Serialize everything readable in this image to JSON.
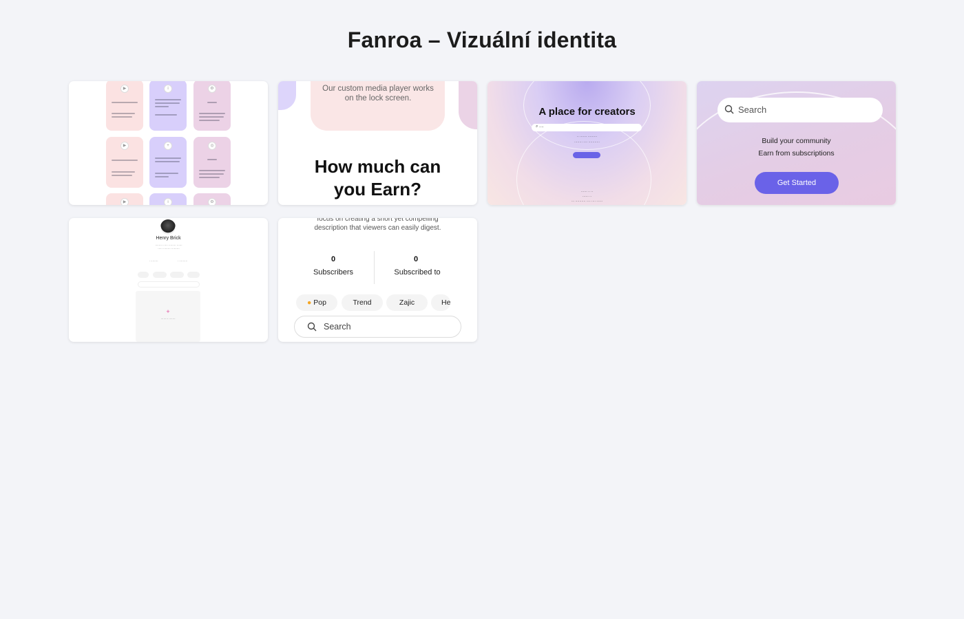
{
  "page": {
    "title": "Fanroa – Vizuální identita"
  },
  "cards": {
    "card2": {
      "text": "Our custom media player works on the lock screen.",
      "heading": "How much can you Earn?"
    },
    "card3": {
      "heading": "A place for creators"
    },
    "card4": {
      "search_placeholder": "Search",
      "line1": "Build your community",
      "line2": "Earn from subscriptions",
      "button": "Get Started"
    },
    "card5": {
      "name": "Henry Brick"
    },
    "card6": {
      "description": "focus on creating a short yet compelling description that viewers can easily digest.",
      "subscribers_count": "0",
      "subscribers_label": "Subscribers",
      "subscribed_count": "0",
      "subscribed_label": "Subscribed to",
      "chips": [
        "Pop",
        "Trend",
        "Zajic",
        "He"
      ],
      "search_placeholder": "Search"
    }
  },
  "colors": {
    "accent": "#6a62e8",
    "background": "#f3f4f8",
    "lavender": "#ddd5fb",
    "pink": "#fae6e6"
  }
}
